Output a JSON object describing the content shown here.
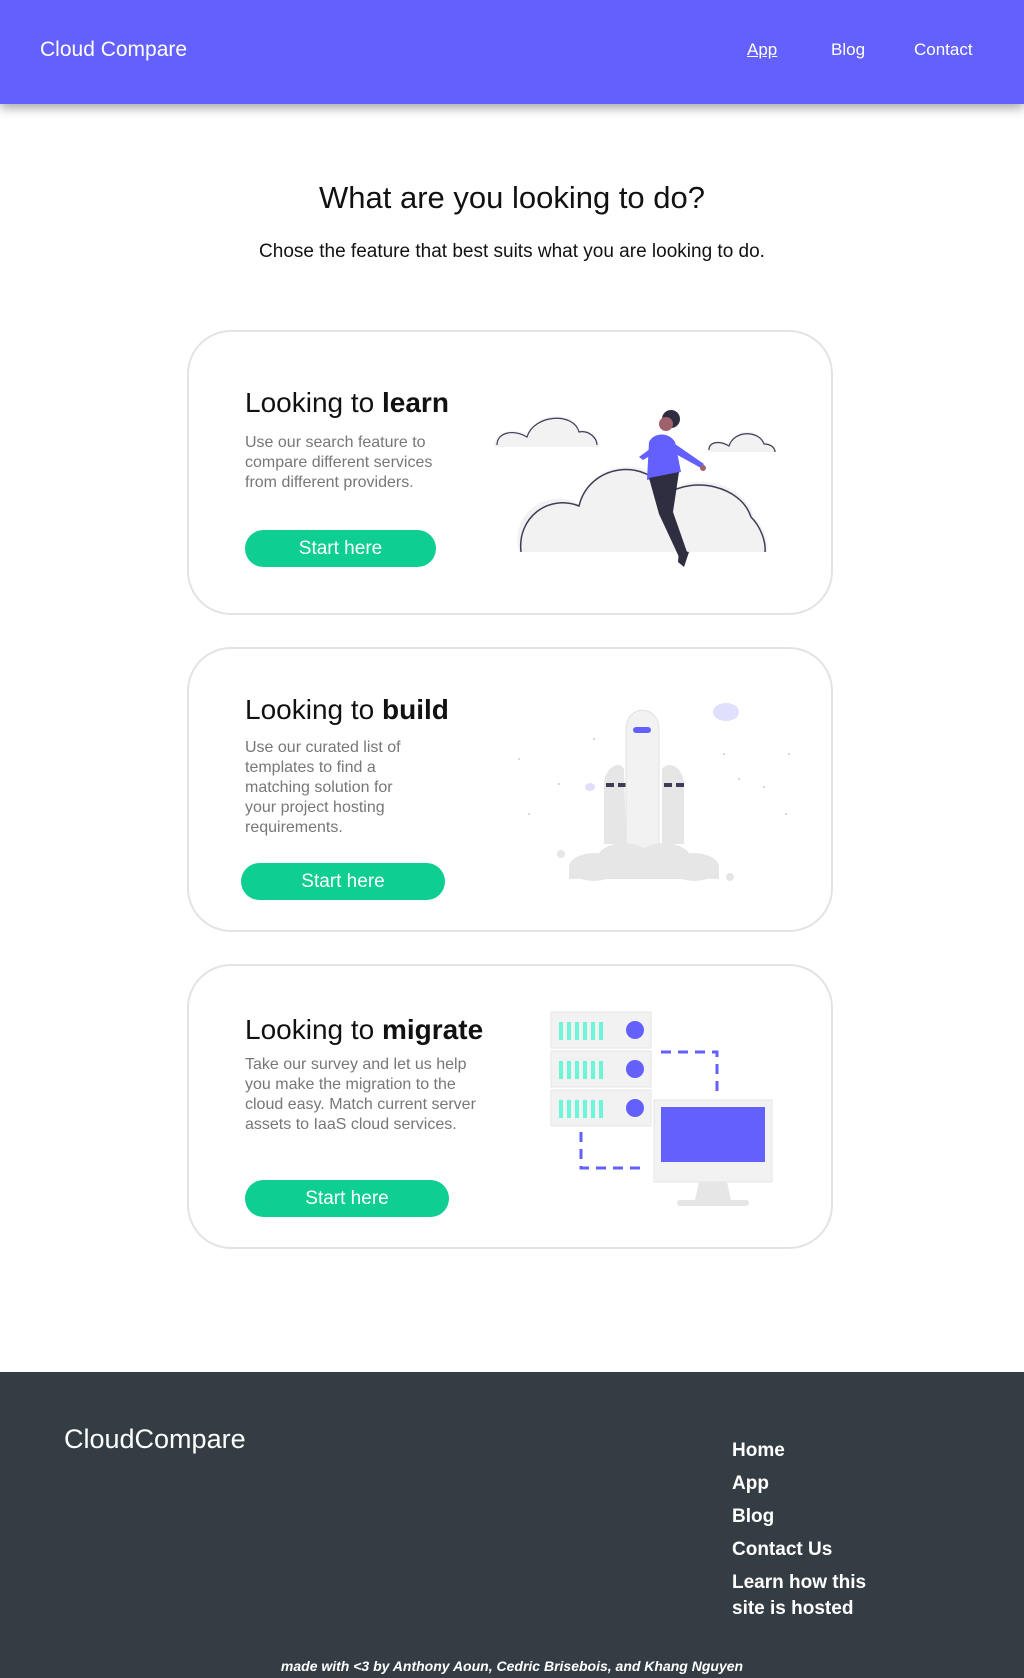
{
  "header": {
    "brand": "Cloud Compare",
    "nav": [
      {
        "label": "App"
      },
      {
        "label": "Blog"
      },
      {
        "label": "Contact"
      }
    ]
  },
  "intro": {
    "title": "What are you looking to do?",
    "subtitle": "Chose the feature that best suits what you are looking to do."
  },
  "cards": [
    {
      "title_prefix": "Looking to ",
      "title_bold": "learn",
      "description": "Use our search feature to compare different services from different providers.",
      "button": "Start here",
      "illustration": "person-flying-clouds"
    },
    {
      "title_prefix": "Looking to ",
      "title_bold": "build",
      "description": "Use our curated list of templates to find a matching solution for your project hosting requirements.",
      "button": "Start here",
      "illustration": "rocket-launch"
    },
    {
      "title_prefix": "Looking to ",
      "title_bold": "migrate",
      "description": "Take our survey and let us help you make the migration to the cloud easy. Match current server assets to IaaS cloud services.",
      "button": "Start here",
      "illustration": "server-to-monitor"
    }
  ],
  "footer": {
    "brand": "CloudCompare",
    "links": [
      {
        "label": "Home"
      },
      {
        "label": "App"
      },
      {
        "label": "Blog"
      },
      {
        "label": "Contact Us"
      },
      {
        "label": "Learn how this site is hosted"
      }
    ],
    "credit": "made with <3 by Anthony Aoun, Cedric Brisebois, and Khang Nguyen"
  },
  "colors": {
    "primary": "#6360fe",
    "accent": "#0fce92",
    "footer_bg": "#343d43",
    "card_border": "#e3e3e3"
  }
}
